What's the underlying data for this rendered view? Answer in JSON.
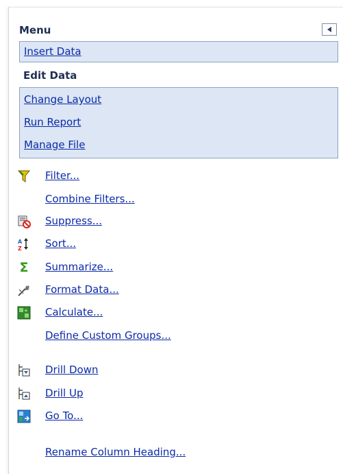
{
  "menu": {
    "title": "Menu",
    "collapse_icon": "collapse-left-icon"
  },
  "sections": {
    "insert_data": "Insert Data",
    "edit_data": "Edit Data",
    "change_layout": "Change Layout",
    "run_report": "Run Report",
    "manage_file": "Manage File"
  },
  "edit_items": [
    {
      "label": "Filter...",
      "icon": "filter-funnel-icon",
      "icon_color": "#e7c400"
    },
    {
      "label": "Combine Filters...",
      "icon": ""
    },
    {
      "label": "Suppress...",
      "icon": "suppress-icon",
      "icon_color": "#d9261c"
    },
    {
      "label": "Sort...",
      "icon": "sort-icon",
      "icon_color": "#2d62b8"
    },
    {
      "label": "Summarize...",
      "icon": "sigma-icon",
      "icon_color": "#3a9a1c"
    },
    {
      "label": "Format Data...",
      "icon": "format-data-icon"
    },
    {
      "label": "Calculate...",
      "icon": "calculate-icon",
      "icon_color": "#2e8b2e"
    },
    {
      "label": "Define Custom Groups...",
      "icon": ""
    },
    {
      "label": "Drill Down",
      "icon": "drill-down-icon"
    },
    {
      "label": "Drill Up",
      "icon": "drill-up-icon"
    },
    {
      "label": "Go To...",
      "icon": "go-to-icon",
      "icon_color": "#2b7fcf"
    },
    {
      "label": "Rename Column Heading...",
      "icon": ""
    }
  ],
  "colors": {
    "link": "#0b2aa8",
    "section_bg": "#dce6f4",
    "section_border": "#8fa3c3",
    "header_text": "#1f2f52"
  }
}
